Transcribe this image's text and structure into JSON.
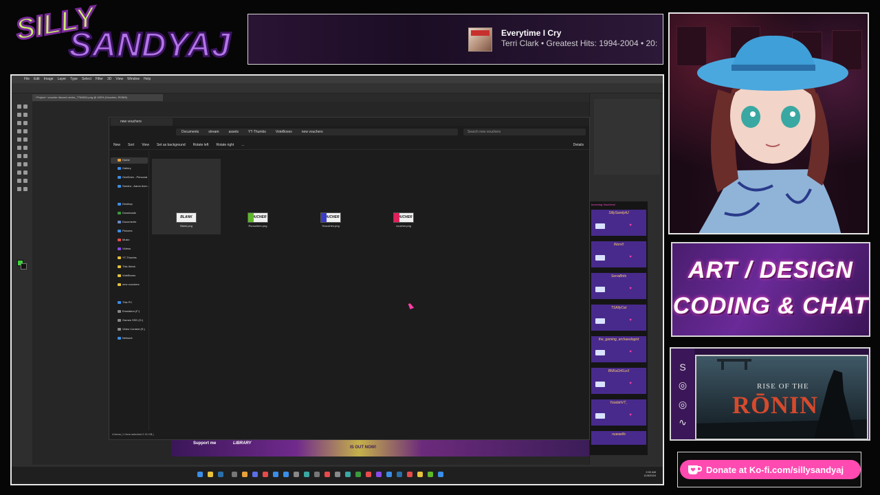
{
  "brand": {
    "name": "SILLY SANDYAJ",
    "line1": "SILLY",
    "line2": "SANDYAJ"
  },
  "now_playing": {
    "title": "Everytime I Cry",
    "subtitle": "Terri Clark • Greatest Hits: 1994-2004 • 20:"
  },
  "art_panel": {
    "line1": "ART / DESIGN",
    "line2": "CODING & CHAT"
  },
  "game_panel": {
    "subtitle": "RISE OF THE",
    "title": "RŌNIN"
  },
  "kofi": {
    "label": "Donate at Ko-fi.com/sillysandyaj"
  },
  "photoshop": {
    "menu": [
      "File",
      "Edit",
      "Image",
      "Layer",
      "Type",
      "Select",
      "Filter",
      "3D",
      "View",
      "Window",
      "Help"
    ],
    "doc_tab": "~Project~ voucher discord vector_7766824.png @ 400% (Vouches, RGB/8)"
  },
  "explorer": {
    "tab_title": "new vouchers",
    "breadcrumb": [
      "Documents",
      "stream",
      "assets",
      "YT-Thumbs",
      "VoteBoxes",
      "new vouchers"
    ],
    "search_placeholder": "Search new vouchers",
    "commands": [
      "New",
      "Sort",
      "View",
      "Set as background",
      "Rotate left",
      "Rotate right",
      "...",
      "Details"
    ],
    "nav": [
      {
        "label": "Home",
        "color": "#e8a03a"
      },
      {
        "label": "Gallery",
        "color": "#3a8ee8"
      },
      {
        "label": "OneDrive - Personal",
        "color": "#3a8ee8"
      },
      {
        "label": "Sandra - Aaron Aver...",
        "color": "#3a8ee8"
      },
      {
        "label": "Desktop",
        "color": "#3a8ee8"
      },
      {
        "label": "Downloads",
        "color": "#3a9a3a"
      },
      {
        "label": "Documents",
        "color": "#6a8ac8"
      },
      {
        "label": "Pictures",
        "color": "#3a8ee8"
      },
      {
        "label": "Music",
        "color": "#e84a4a"
      },
      {
        "label": "Videos",
        "color": "#8a4ae8"
      },
      {
        "label": "YT-Thumbs",
        "color": "#e8c23a"
      },
      {
        "label": "This Week",
        "color": "#e8c23a"
      },
      {
        "label": "VoteBoxes",
        "color": "#e8c23a"
      },
      {
        "label": "new vouchers",
        "color": "#e8c23a"
      },
      {
        "label": "This PC",
        "color": "#3a8ee8"
      },
      {
        "label": "Emulation (F:)",
        "color": "#888888"
      },
      {
        "label": "Games SSD (G:)",
        "color": "#888888"
      },
      {
        "label": "Video Content (E:)",
        "color": "#888888"
      },
      {
        "label": "Network",
        "color": "#3a8ee8"
      }
    ],
    "files": [
      {
        "thumb": "BLANK",
        "name": "Blank.png",
        "accent": "#ffffff"
      },
      {
        "thumb": "VOUCHER",
        "name": "Rvouchers.png",
        "accent": "#5fb82a"
      },
      {
        "thumb": "VOUCHER",
        "name": "Svouches.png",
        "accent": "#3a3ac8"
      },
      {
        "thumb": "VOUCHER",
        "name": "voucher.png",
        "accent": "#e0205a"
      }
    ],
    "status": "4 items  |  1 item selected 2.31 KB  |"
  },
  "chat": {
    "header": "Incoming Vouchers!",
    "messages": [
      "SillySandyAJ",
      "iNorv0",
      "SerraBrits",
      "TSAllyCat",
      "the_gaming_archaeologist",
      "BNKaOrKLeX",
      "YoodahVT_"
    ],
    "footer": "nuwaelfs"
  },
  "overlay_strip": {
    "support": "Support me",
    "library": "LIBRARY",
    "out_now": "IS OUT NOW!"
  },
  "taskbar": {
    "time": "2:00 AM",
    "date": "11/6/2024"
  }
}
